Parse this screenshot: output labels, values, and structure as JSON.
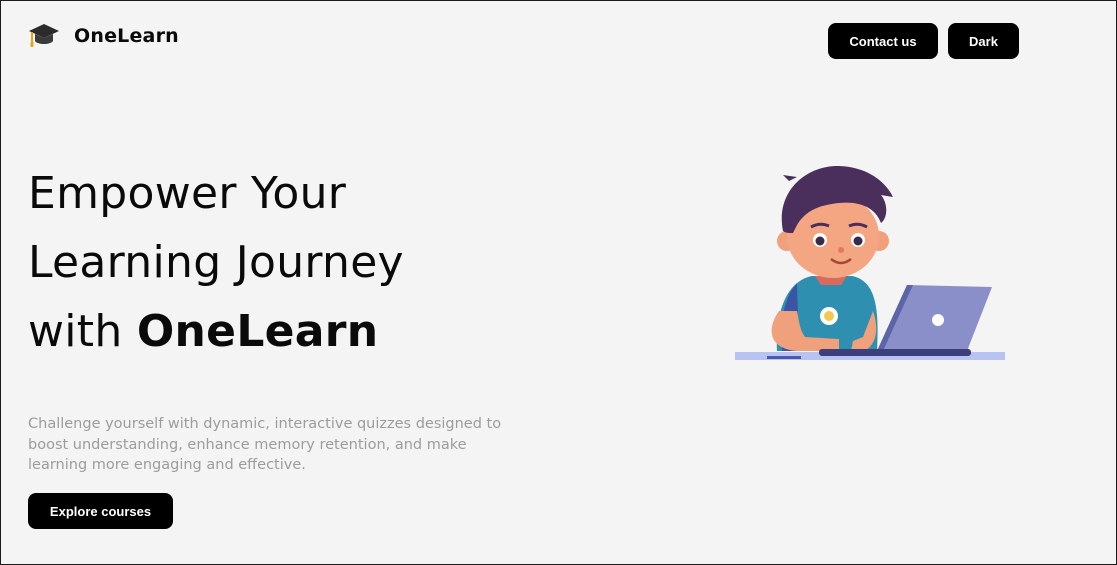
{
  "header": {
    "brand_name": "OneLearn",
    "logo_icon": "graduation-cap-icon",
    "contact_label": "Contact us",
    "theme_label": "Dark"
  },
  "hero": {
    "title_line1": "Empower Your",
    "title_line2": "Learning Journey",
    "title_line3_prefix": "with ",
    "title_line3_brand": "OneLearn",
    "description": "Challenge yourself with dynamic, interactive quizzes designed to boost understanding, enhance memory retention, and make learning more engaging and effective.",
    "cta_label": "Explore courses",
    "illustration": "boy-with-laptop-illustration"
  },
  "colors": {
    "background": "#f4f4f4",
    "button": "#000000",
    "description_text": "#9c9c9c",
    "laptop": "#8b8fc9",
    "shirt": "#2e8fb0",
    "hair": "#4a2f5c"
  }
}
